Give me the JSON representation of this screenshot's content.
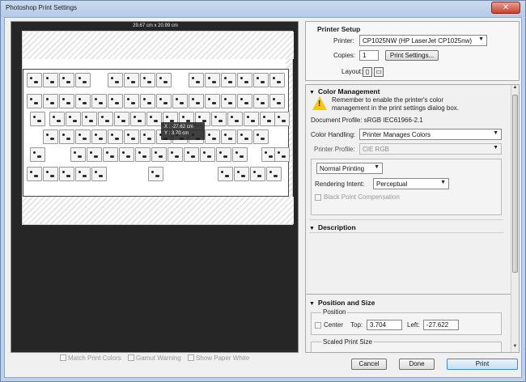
{
  "window": {
    "title": "Photoshop Print Settings",
    "close_glyph": "✕"
  },
  "preview": {
    "paper_size": "29.67 cm x 20.99 cm",
    "tooltip": {
      "x_label": "X :",
      "x_value": "-27.62 cm",
      "y_label": "Y :",
      "y_value": "3.70 cm"
    }
  },
  "bottom_options": {
    "match_print_colors": "Match Print Colors",
    "gamut_warning": "Gamut Warning",
    "show_paper_white": "Show Paper White"
  },
  "printer_setup": {
    "heading": "Printer Setup",
    "printer_label": "Printer:",
    "printer_value": "CP1025NW (HP LaserJet CP1025nw)",
    "copies_label": "Copies:",
    "copies_value": "1",
    "print_settings_button": "Print Settings...",
    "layout_label": "Layout:",
    "layout_icons": [
      "portrait-icon",
      "landscape-icon"
    ]
  },
  "color_management": {
    "heading": "Color Management",
    "warning": "Remember to enable the printer's color management in the print settings dialog box.",
    "document_profile": "Document Profile: sRGB IEC61966-2.1",
    "color_handling_label": "Color Handling:",
    "color_handling_value": "Printer Manages Colors",
    "printer_profile_label": "Printer Profile:",
    "printer_profile_value": "CIE RGB",
    "normal_printing_value": "Normal Printing",
    "rendering_intent_label": "Rendering Intent:",
    "rendering_intent_value": "Perceptual",
    "black_point_label": "Black Point Compensation"
  },
  "description": {
    "heading": "Description"
  },
  "position_size": {
    "heading": "Position and Size",
    "position_label": "Position",
    "center_label": "Center",
    "top_label": "Top:",
    "top_value": "3.704",
    "left_label": "Left:",
    "left_value": "-27.622",
    "scaled_label": "Scaled Print Size"
  },
  "footer": {
    "cancel": "Cancel",
    "done": "Done",
    "print": "Print"
  }
}
